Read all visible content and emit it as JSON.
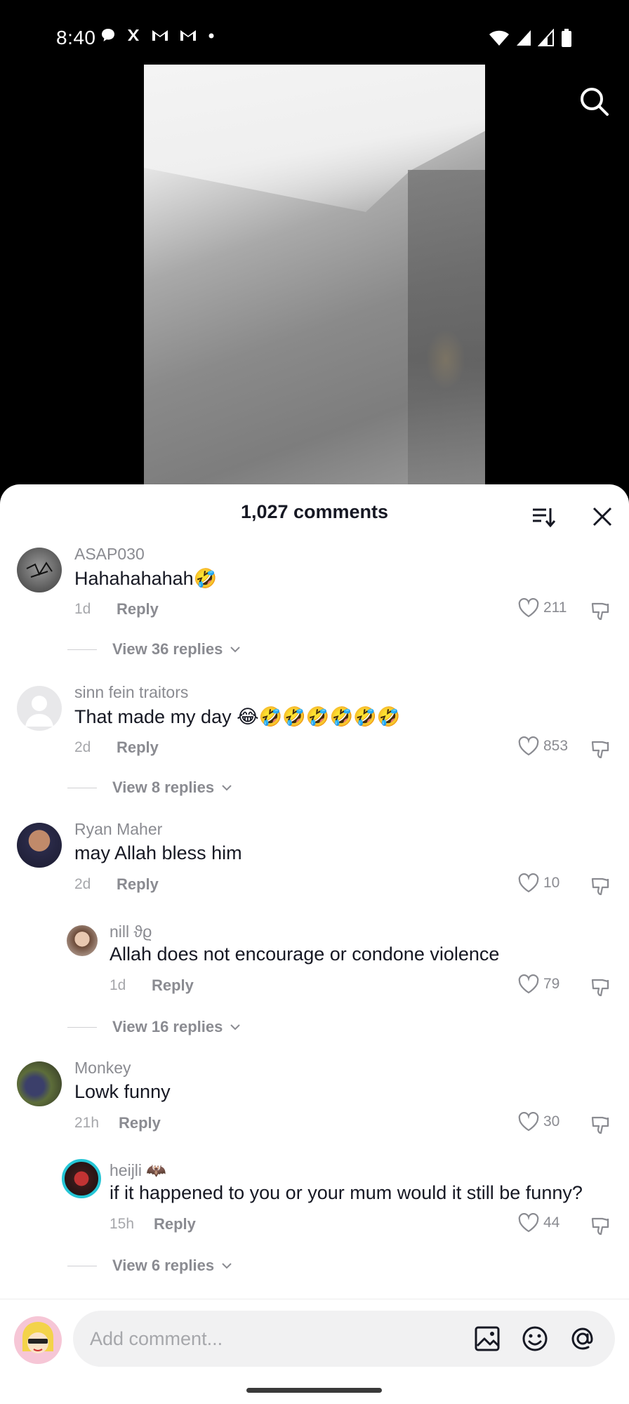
{
  "status_bar": {
    "time": "8:40",
    "left_icons": [
      "chat-bubble-icon",
      "x-app-icon",
      "gmail-icon",
      "gmail-icon",
      "dot-icon"
    ],
    "right_icons": [
      "wifi-icon",
      "signal-icon",
      "signal-icon",
      "battery-icon"
    ]
  },
  "header": {
    "title": "1,027 comments"
  },
  "comments": [
    {
      "user": "ASAP030",
      "text": "Hahahahahah🤣",
      "time": "1d",
      "reply_label": "Reply",
      "likes": "211",
      "view_replies": "View 36 replies"
    },
    {
      "user": "sinn fein traitors",
      "text": "That made my day 😂🤣🤣🤣🤣🤣🤣",
      "time": "2d",
      "reply_label": "Reply",
      "likes": "853",
      "view_replies": "View 8 replies"
    },
    {
      "user": "Ryan Maher",
      "text": "may Allah bless him",
      "time": "2d",
      "reply_label": "Reply",
      "likes": "10",
      "reply": {
        "user": "nill ϑϱ",
        "text": "Allah does not encourage or condone violence",
        "time": "1d",
        "reply_label": "Reply",
        "likes": "79"
      },
      "view_replies": "View 16 replies"
    },
    {
      "user": "Monkey",
      "text": "Lowk funny",
      "time": "21h",
      "reply_label": "Reply",
      "likes": "30",
      "reply": {
        "user": "heijli 🦇",
        "text": "if it happened to you or your mum would it still be funny?",
        "time": "15h",
        "reply_label": "Reply",
        "likes": "44"
      },
      "view_replies": "View 6 replies"
    }
  ],
  "composer": {
    "placeholder": "Add comment...",
    "icons": [
      "image-icon",
      "emoji-icon",
      "mention-icon"
    ]
  },
  "colors": {
    "text_primary": "#161823",
    "text_secondary": "#8a8b91",
    "sheet_background": "#ffffff",
    "input_background": "#f1f1f2"
  }
}
